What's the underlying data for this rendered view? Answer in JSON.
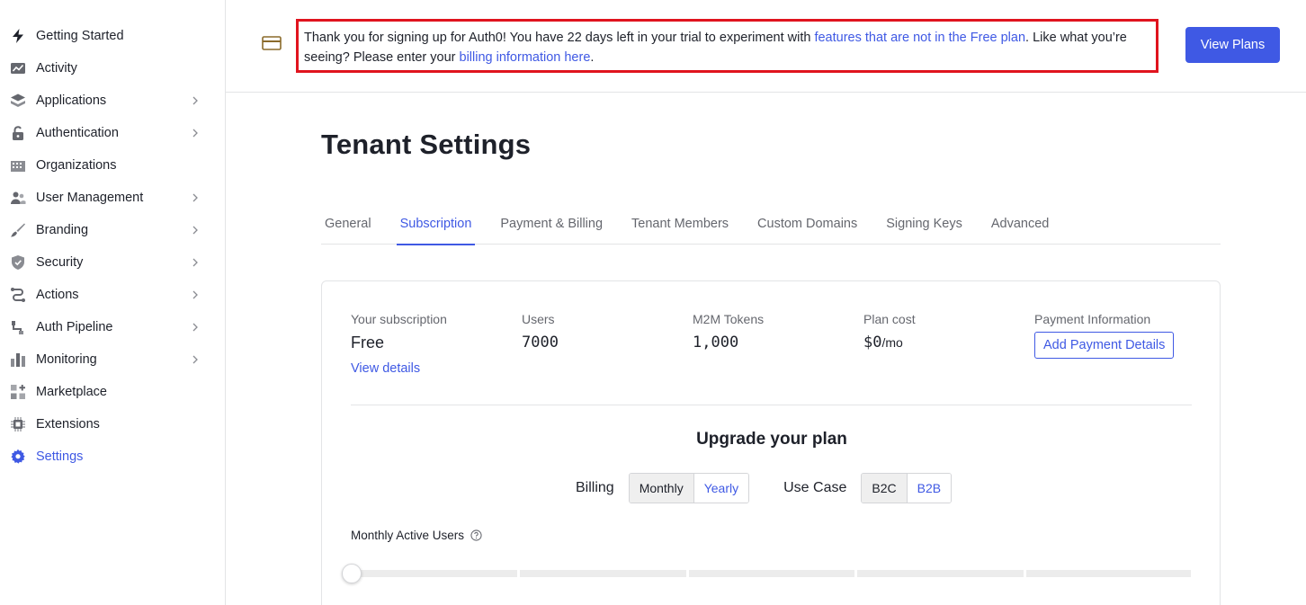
{
  "sidebar": {
    "items": [
      {
        "label": "Getting Started",
        "icon": "lightning-icon",
        "chevron": false,
        "active": false
      },
      {
        "label": "Activity",
        "icon": "activity-chart-icon",
        "chevron": false,
        "active": false
      },
      {
        "label": "Applications",
        "icon": "layers-icon",
        "chevron": true,
        "active": false
      },
      {
        "label": "Authentication",
        "icon": "lock-icon",
        "chevron": true,
        "active": false
      },
      {
        "label": "Organizations",
        "icon": "building-icon",
        "chevron": false,
        "active": false
      },
      {
        "label": "User Management",
        "icon": "users-icon",
        "chevron": true,
        "active": false
      },
      {
        "label": "Branding",
        "icon": "brush-icon",
        "chevron": true,
        "active": false
      },
      {
        "label": "Security",
        "icon": "shield-icon",
        "chevron": true,
        "active": false
      },
      {
        "label": "Actions",
        "icon": "flow-icon",
        "chevron": true,
        "active": false
      },
      {
        "label": "Auth Pipeline",
        "icon": "pipeline-icon",
        "chevron": true,
        "active": false
      },
      {
        "label": "Monitoring",
        "icon": "bar-chart-icon",
        "chevron": true,
        "active": false
      },
      {
        "label": "Marketplace",
        "icon": "grid-plus-icon",
        "chevron": false,
        "active": false
      },
      {
        "label": "Extensions",
        "icon": "chip-icon",
        "chevron": false,
        "active": false
      },
      {
        "label": "Settings",
        "icon": "gear-icon",
        "chevron": false,
        "active": true
      }
    ]
  },
  "banner": {
    "icon": "credit-card-icon",
    "text_1": "Thank you for signing up for Auth0! You have 22 days left in your trial to experiment with ",
    "link_1": "features that are not in the Free plan",
    "text_2": ". Like what you’re seeing? Please enter your ",
    "link_2": "billing information here",
    "text_3": ".",
    "button_label": "View Plans"
  },
  "page": {
    "title": "Tenant Settings",
    "tabs": [
      {
        "label": "General",
        "active": false
      },
      {
        "label": "Subscription",
        "active": true
      },
      {
        "label": "Payment & Billing",
        "active": false
      },
      {
        "label": "Tenant Members",
        "active": false
      },
      {
        "label": "Custom Domains",
        "active": false
      },
      {
        "label": "Signing Keys",
        "active": false
      },
      {
        "label": "Advanced",
        "active": false
      }
    ]
  },
  "subscription": {
    "plan_label": "Your subscription",
    "plan_value": "Free",
    "view_details": "View details",
    "users_label": "Users",
    "users_value": "7000",
    "m2m_label": "M2M Tokens",
    "m2m_value": "1,000",
    "cost_label": "Plan cost",
    "cost_value": "$0",
    "cost_unit": "/mo",
    "payment_label": "Payment Information",
    "payment_button": "Add Payment Details"
  },
  "upgrade": {
    "title": "Upgrade your plan",
    "billing_label": "Billing",
    "billing_options": [
      "Monthly",
      "Yearly"
    ],
    "billing_selected": "Monthly",
    "usecase_label": "Use Case",
    "usecase_options": [
      "B2C",
      "B2B"
    ],
    "usecase_selected": "B2C",
    "mau_label": "Monthly Active Users",
    "slider_value_fraction": 0
  },
  "colors": {
    "accent": "#3f59e4",
    "banner_border": "#e0141e",
    "text": "#1e212a",
    "muted": "#65676e"
  }
}
